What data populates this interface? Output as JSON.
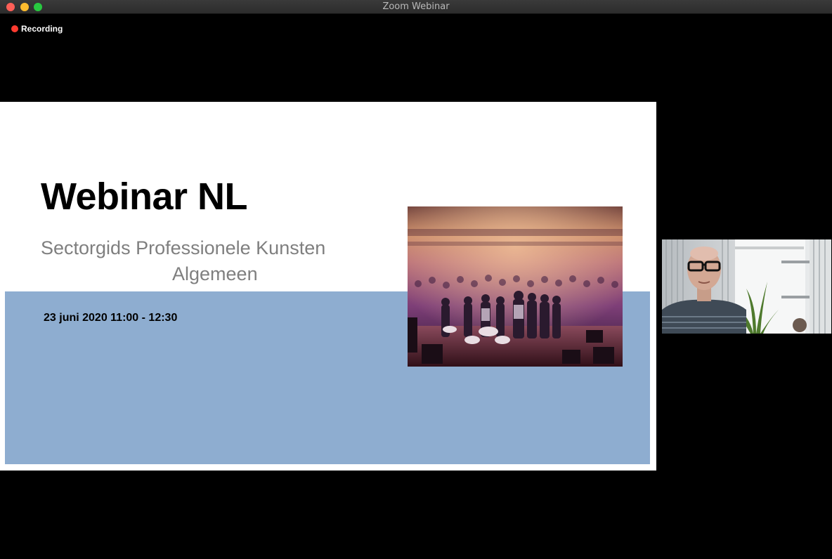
{
  "window": {
    "title": "Zoom Webinar"
  },
  "recording": {
    "label": "Recording",
    "icon": "record-dot-icon",
    "color": "#ff3b30"
  },
  "slide": {
    "title": "Webinar NL",
    "subtitle_line1": "Sectorgids Professionele Kunsten",
    "subtitle_line2": "Algemeen",
    "date": "23 juni 2020 11:00 - 12:30",
    "band_color": "#8eadd0"
  },
  "colors": {
    "close": "#ff5f57",
    "minimize": "#febc2e",
    "maximize": "#28c840"
  }
}
